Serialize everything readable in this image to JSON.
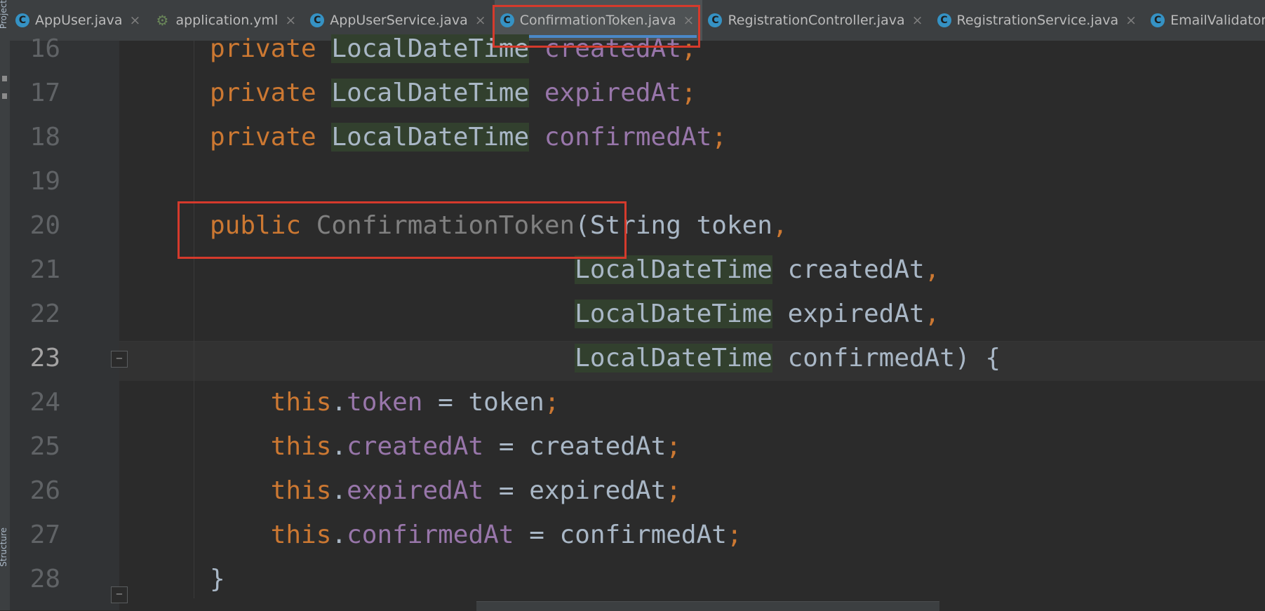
{
  "left_strip": {
    "top_label": "Project",
    "bottom_label": "Structure"
  },
  "tabs": [
    {
      "label": "AppUser.java",
      "icon": "C",
      "active": false
    },
    {
      "label": "application.yml",
      "icon": "yml-icon",
      "active": false
    },
    {
      "label": "AppUserService.java",
      "icon": "C",
      "active": false
    },
    {
      "label": "ConfirmationToken.java",
      "icon": "C",
      "active": true
    },
    {
      "label": "RegistrationController.java",
      "icon": "C",
      "active": false
    },
    {
      "label": "RegistrationService.java",
      "icon": "C",
      "active": false
    },
    {
      "label": "EmailValidator.ja",
      "icon": "C",
      "active": false
    }
  ],
  "close_glyph": "×",
  "editor": {
    "current_line": 23,
    "lines": [
      {
        "num": "16",
        "tokens": [
          [
            "kw",
            "private "
          ],
          [
            "hl",
            "LocalDateTime"
          ],
          [
            "plain",
            " "
          ],
          [
            "fld",
            "createdAt"
          ],
          [
            "kw",
            ";"
          ]
        ]
      },
      {
        "num": "17",
        "tokens": [
          [
            "kw",
            "private "
          ],
          [
            "hl",
            "LocalDateTime"
          ],
          [
            "plain",
            " "
          ],
          [
            "fld",
            "expiredAt"
          ],
          [
            "kw",
            ";"
          ]
        ]
      },
      {
        "num": "18",
        "tokens": [
          [
            "kw",
            "private "
          ],
          [
            "hl",
            "LocalDateTime"
          ],
          [
            "plain",
            " "
          ],
          [
            "fld",
            "confirmedAt"
          ],
          [
            "kw",
            ";"
          ]
        ]
      },
      {
        "num": "19",
        "tokens": []
      },
      {
        "num": "20",
        "tokens": [
          [
            "kw",
            "public "
          ],
          [
            "ctor",
            "ConfirmationToken"
          ],
          [
            "plain",
            "(String token"
          ],
          [
            "kw",
            ","
          ]
        ]
      },
      {
        "num": "21",
        "tokens": [
          [
            "plain",
            "                        "
          ],
          [
            "hl",
            "LocalDateTime"
          ],
          [
            "plain",
            " createdAt"
          ],
          [
            "kw",
            ","
          ]
        ]
      },
      {
        "num": "22",
        "tokens": [
          [
            "plain",
            "                        "
          ],
          [
            "hl",
            "LocalDateTime"
          ],
          [
            "plain",
            " expiredAt"
          ],
          [
            "kw",
            ","
          ]
        ]
      },
      {
        "num": "23",
        "tokens": [
          [
            "plain",
            "                        "
          ],
          [
            "hl",
            "LocalDateTime"
          ],
          [
            "plain",
            " confirmedAt) {"
          ]
        ]
      },
      {
        "num": "24",
        "tokens": [
          [
            "plain",
            "    "
          ],
          [
            "kw",
            "this"
          ],
          [
            "plain",
            "."
          ],
          [
            "fld",
            "token"
          ],
          [
            "plain",
            " = token"
          ],
          [
            "kw",
            ";"
          ]
        ]
      },
      {
        "num": "25",
        "tokens": [
          [
            "plain",
            "    "
          ],
          [
            "kw",
            "this"
          ],
          [
            "plain",
            "."
          ],
          [
            "fld",
            "createdAt"
          ],
          [
            "plain",
            " = createdAt"
          ],
          [
            "kw",
            ";"
          ]
        ]
      },
      {
        "num": "26",
        "tokens": [
          [
            "plain",
            "    "
          ],
          [
            "kw",
            "this"
          ],
          [
            "plain",
            "."
          ],
          [
            "fld",
            "expiredAt"
          ],
          [
            "plain",
            " = expiredAt"
          ],
          [
            "kw",
            ";"
          ]
        ]
      },
      {
        "num": "27",
        "tokens": [
          [
            "plain",
            "    "
          ],
          [
            "kw",
            "this"
          ],
          [
            "plain",
            "."
          ],
          [
            "fld",
            "confirmedAt"
          ],
          [
            "plain",
            " = confirmedAt"
          ],
          [
            "kw",
            ";"
          ]
        ]
      },
      {
        "num": "28",
        "tokens": [
          [
            "plain",
            "}"
          ]
        ]
      }
    ]
  },
  "colors": {
    "keyword": "#cc7832",
    "field": "#9876aa",
    "text": "#a9b7c6",
    "annotation_box": "#d53a2c",
    "active_tab_underline": "#4a88c7"
  }
}
